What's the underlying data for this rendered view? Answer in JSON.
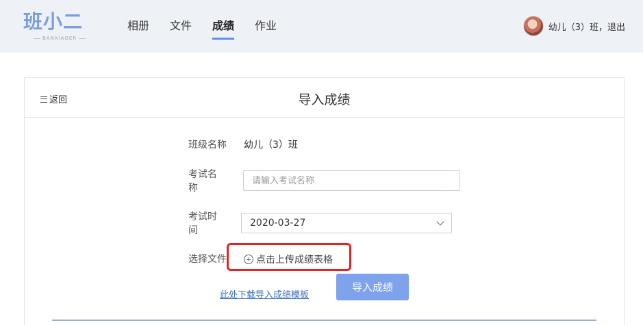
{
  "header": {
    "logo_text": "班小二",
    "logo_sub": "BANXIAOER",
    "nav": [
      {
        "label": "相册",
        "active": false
      },
      {
        "label": "文件",
        "active": false
      },
      {
        "label": "成绩",
        "active": true
      },
      {
        "label": "作业",
        "active": false
      }
    ],
    "user_text": "幼儿（3）班，退出",
    "accent_color": "#5b8ff3"
  },
  "panel": {
    "back_label": "返回",
    "title": "导入成绩"
  },
  "form": {
    "class_name_label": "班级名称",
    "class_name_value": "幼儿（3）班",
    "exam_name_label_1": "考试名",
    "exam_name_label_2": "称",
    "exam_name_placeholder": "请输入考试名称",
    "exam_time_label_1": "考试时",
    "exam_time_label_2": "间",
    "exam_time_value": "2020-03-27",
    "file_label": "选择文件",
    "upload_label": "点击上传成绩表格",
    "download_link": "此处下载导入成绩模板",
    "import_button": "导入成绩"
  }
}
